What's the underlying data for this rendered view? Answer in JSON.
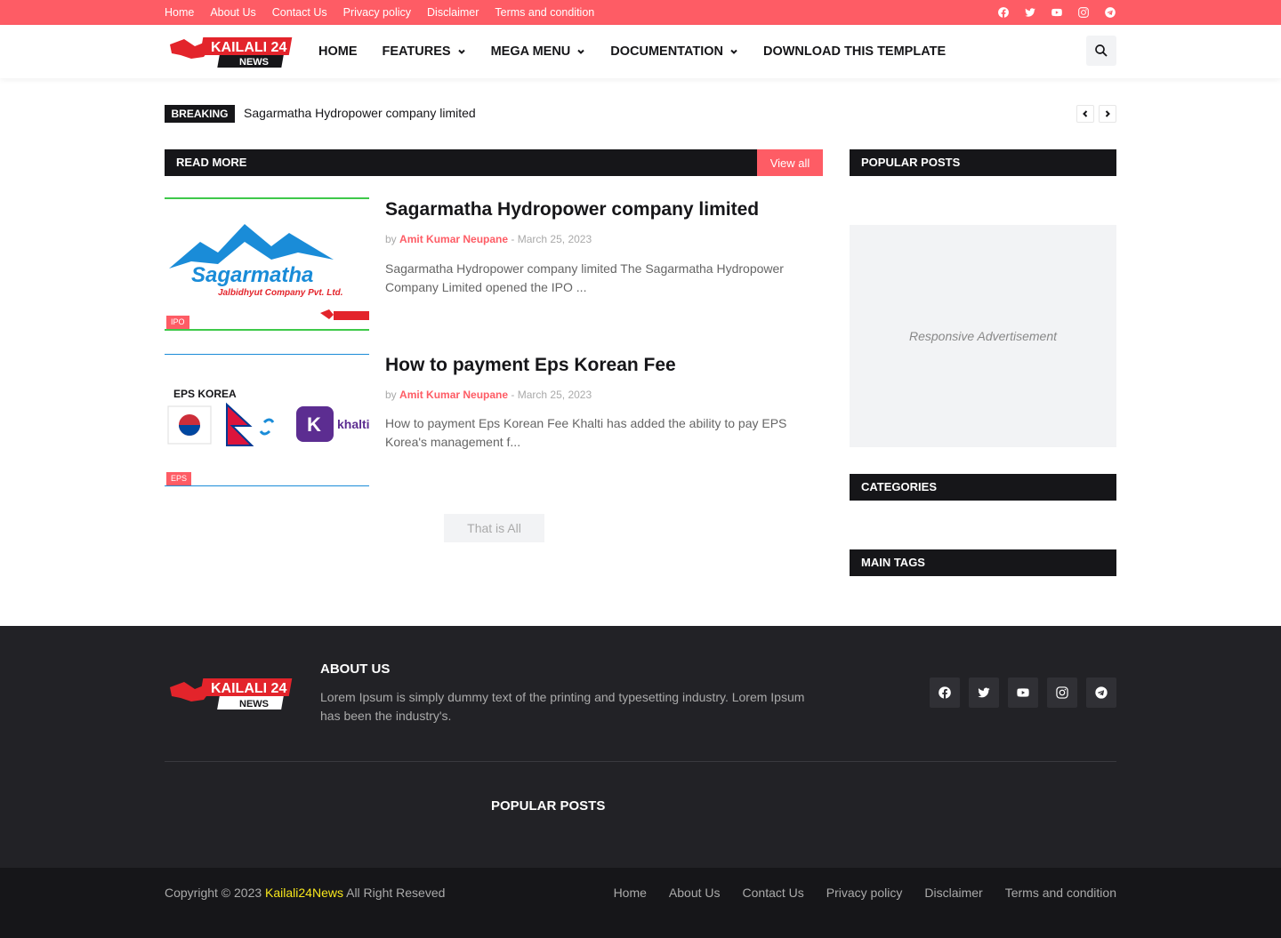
{
  "topbar": {
    "links": [
      "Home",
      "About Us",
      "Contact Us",
      "Privacy policy",
      "Disclaimer",
      "Terms and condition"
    ],
    "social_icons": [
      "facebook-icon",
      "twitter-icon",
      "youtube-icon",
      "instagram-icon",
      "telegram-icon"
    ]
  },
  "header": {
    "logo_text": "KAILALI 24",
    "logo_subtext": "NEWS",
    "nav": [
      {
        "label": "Home",
        "has_dropdown": false
      },
      {
        "label": "Features",
        "has_dropdown": true
      },
      {
        "label": "Mega Menu",
        "has_dropdown": true
      },
      {
        "label": "Documentation",
        "has_dropdown": true
      },
      {
        "label": "Download This Template",
        "has_dropdown": false
      }
    ]
  },
  "ticker": {
    "tag": "Breaking",
    "headline": "Sagarmatha Hydropower company limited"
  },
  "main": {
    "section_title": "Read More",
    "view_all": "View all",
    "posts": [
      {
        "title": "Sagarmatha Hydropower company limited",
        "by": "by",
        "author": "Amit Kumar Neupane",
        "sep": "-",
        "date": "March 25, 2023",
        "snippet": "Sagarmatha Hydropower company limited  The Sagarmatha Hydropower Company Limited opened the IPO ...",
        "category": "IPO",
        "thumb_text": "Sagarmatha",
        "thumb_subtext": "Jalbidhyut Company Pvt. Ltd."
      },
      {
        "title": "How to payment Eps Korean Fee",
        "by": "by",
        "author": "Amit Kumar Neupane",
        "sep": "-",
        "date": "March 25, 2023",
        "snippet": "How to payment Eps Korean Fee  Khalti has added the ability to pay EPS Korea's management f...",
        "category": "EPS",
        "thumb_text": "EPS KOREA",
        "thumb_subtext": "khalti"
      }
    ],
    "load_more": "That is All"
  },
  "sidebar": {
    "popular_title": "Popular Posts",
    "ad_text": "Responsive Advertisement",
    "categories_title": "Categories",
    "tags_title": "Main Tags"
  },
  "footer": {
    "about_title": "About Us",
    "about_text": "Lorem Ipsum is simply dummy text of the printing and typesetting industry. Lorem Ipsum has been the industry's.",
    "popular_title": "Popular Posts",
    "copyright_prefix": "Copyright © 2023",
    "brand": "Kailali24News",
    "copyright_suffix": "All Right Reseved",
    "links": [
      "Home",
      "About Us",
      "Contact Us",
      "Privacy policy",
      "Disclaimer",
      "Terms and condition"
    ]
  },
  "colors": {
    "accent": "#fe5c65",
    "dark": "#161619",
    "footer_bg": "#222226",
    "brand_yellow": "#f8e71c"
  }
}
